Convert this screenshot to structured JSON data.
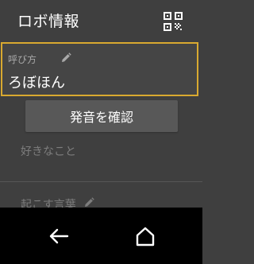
{
  "header": {
    "title": "ロボ情報",
    "qr_icon": "qr-code-icon"
  },
  "name_field": {
    "label": "呼び方",
    "value": "ろぼほん",
    "icon": "pencil-icon",
    "highlight_color": "#d9a930"
  },
  "confirm_button": {
    "label": "発音を確認"
  },
  "favorites": {
    "label": "好きなこと"
  },
  "wake_word": {
    "label": "起こす言葉",
    "icon": "pencil-icon"
  },
  "navbar": {
    "back_icon": "back-arrow-icon",
    "home_icon": "home-icon"
  }
}
